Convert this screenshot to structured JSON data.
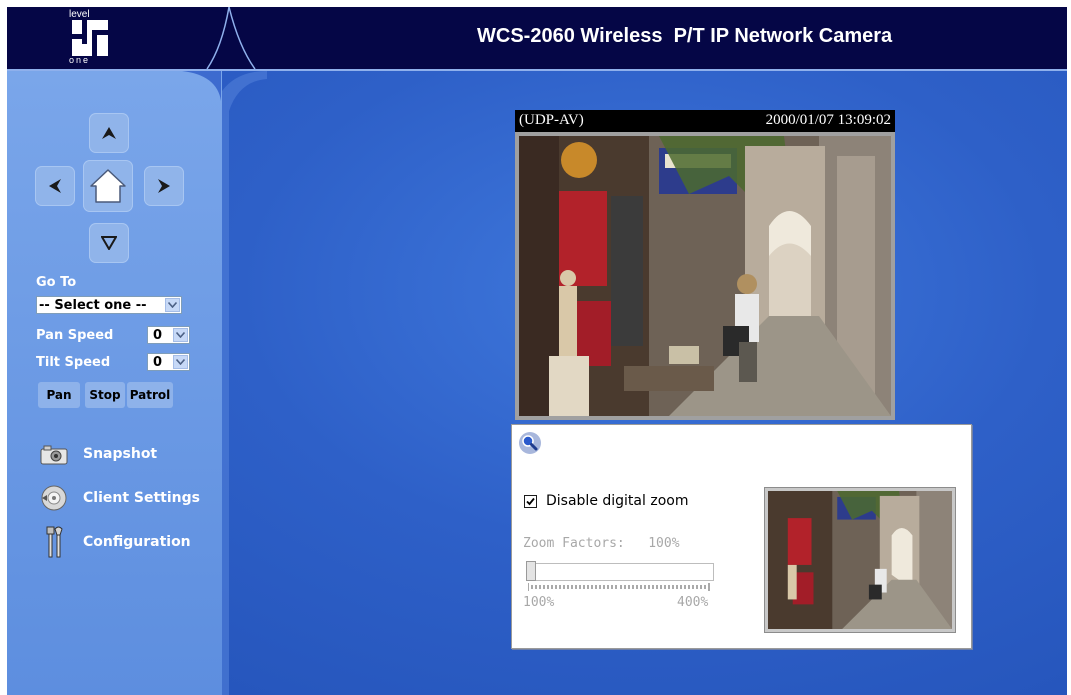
{
  "header": {
    "title": "WCS-2060 Wireless  P/T IP Network Camera",
    "logo_top": "level",
    "logo_bottom": "one"
  },
  "ptz": {
    "up_icon": "arrow-up-icon",
    "down_icon": "arrow-down-icon",
    "left_icon": "arrow-left-icon",
    "right_icon": "arrow-right-icon",
    "home_icon": "home-icon"
  },
  "goto": {
    "label": "Go To",
    "selected": "-- Select one --"
  },
  "pan_speed": {
    "label": "Pan Speed",
    "value": "0"
  },
  "tilt_speed": {
    "label": "Tilt Speed",
    "value": "0"
  },
  "buttons": {
    "pan": "Pan",
    "stop": "Stop",
    "patrol": "Patrol"
  },
  "menu": {
    "snapshot": "Snapshot",
    "client_settings": "Client Settings",
    "configuration": "Configuration"
  },
  "video": {
    "mode": "(UDP-AV)",
    "timestamp": "2000/01/07 13:09:02"
  },
  "zoom": {
    "disable_label": "Disable digital zoom",
    "disable_checked": true,
    "factor_label": "Zoom Factors:",
    "factor_value": "100%",
    "min_label": "100%",
    "max_label": "400%",
    "slider_fraction": 0
  },
  "colors": {
    "header_bg": "#050646",
    "sidebar_bg": "#6b9be6",
    "main_bg": "#2f5cc4",
    "button_bg": "#90b4ea"
  }
}
